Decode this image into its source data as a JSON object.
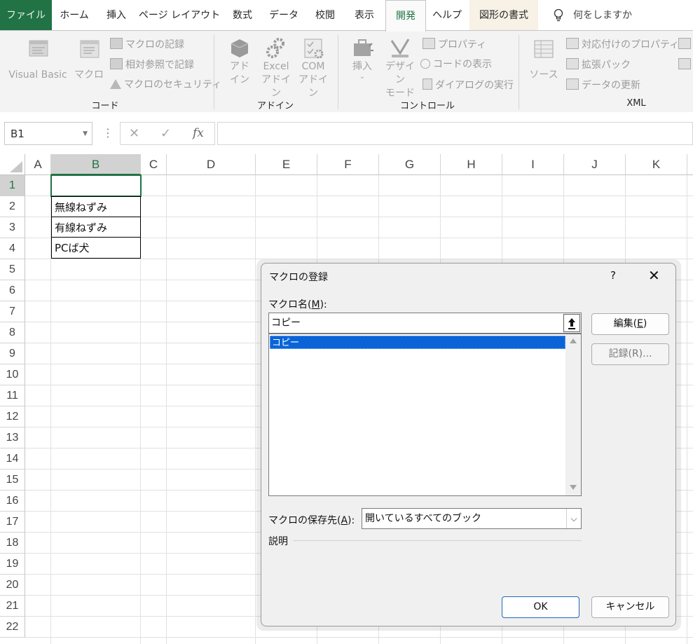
{
  "ribbon_tabs": [
    {
      "label": "ファイル"
    },
    {
      "label": "ホーム"
    },
    {
      "label": "挿入"
    },
    {
      "label": "ページ レイアウト"
    },
    {
      "label": "数式"
    },
    {
      "label": "データ"
    },
    {
      "label": "校閲"
    },
    {
      "label": "表示"
    },
    {
      "label": "開発"
    },
    {
      "label": "ヘルプ"
    },
    {
      "label": "図形の書式"
    }
  ],
  "active_tab": "開発",
  "tell_me": "何をしますか",
  "ribbon": {
    "code_group": {
      "label": "コード",
      "visual_basic": "Visual Basic",
      "macro": "マクロ",
      "record_macro": "マクロの記録",
      "relative_ref": "相対参照で記録",
      "macro_security": "マクロのセキュリティ"
    },
    "addin_group": {
      "label": "アドイン",
      "addin_1": "アド",
      "addin_2": "イン",
      "excel_addin_1": "Excel",
      "excel_addin_2": "アドイン",
      "com_addin_1": "COM",
      "com_addin_2": "アドイン"
    },
    "control_group": {
      "label": "コントロール",
      "insert": "挿入",
      "design_1": "デザイン",
      "design_2": "モード",
      "properties": "プロパティ",
      "view_code": "コードの表示",
      "run_dialog": "ダイアログの実行"
    },
    "xml_group": {
      "label": "XML",
      "source": "ソース",
      "map_properties": "対応付けのプロパティ",
      "expansion_packs": "拡張パック",
      "refresh_data": "データの更新"
    }
  },
  "formula_bar": {
    "name_box": "B1",
    "cancel": "✕",
    "enter": "✓",
    "fx": "fx",
    "content": ""
  },
  "sheet": {
    "columns": [
      "A",
      "B",
      "C",
      "D",
      "E",
      "F",
      "G",
      "H",
      "I",
      "J",
      "K"
    ],
    "rows": [
      "1",
      "2",
      "3",
      "4",
      "5",
      "6",
      "7",
      "8",
      "9",
      "10",
      "11",
      "12",
      "13",
      "14",
      "15",
      "16",
      "17",
      "18",
      "19",
      "20",
      "21",
      "22"
    ],
    "selected_cell": "B1",
    "cells": [
      {
        "ref": "B2",
        "value": "無線ねずみ"
      },
      {
        "ref": "B3",
        "value": "有線ねずみ"
      },
      {
        "ref": "B4",
        "value": "PCば犬"
      }
    ]
  },
  "dialog": {
    "title": "マクロの登録",
    "help": "?",
    "close": "✕",
    "macro_name_label": "マクロ名(",
    "macro_name_key": "M",
    "macro_name_label_end": "):",
    "macro_name_value": "コピー",
    "macro_list": [
      "コピー"
    ],
    "selected_macro": "コピー",
    "edit_button_label": "編集(",
    "edit_button_key": "E",
    "edit_button_end": ")",
    "record_button": "記録(R)...",
    "store_in_label": "マクロの保存先(",
    "store_in_key": "A",
    "store_in_end": "):",
    "store_in_value": "開いているすべてのブック",
    "description_label": "説明",
    "ok_button": "OK",
    "cancel_button": "キャンセル"
  },
  "colors": {
    "excel_green": "#217346",
    "selection_blue": "#0a64d8",
    "ribbon_bg": "#f3f3f3",
    "dialog_bg": "#f0f0f0"
  }
}
